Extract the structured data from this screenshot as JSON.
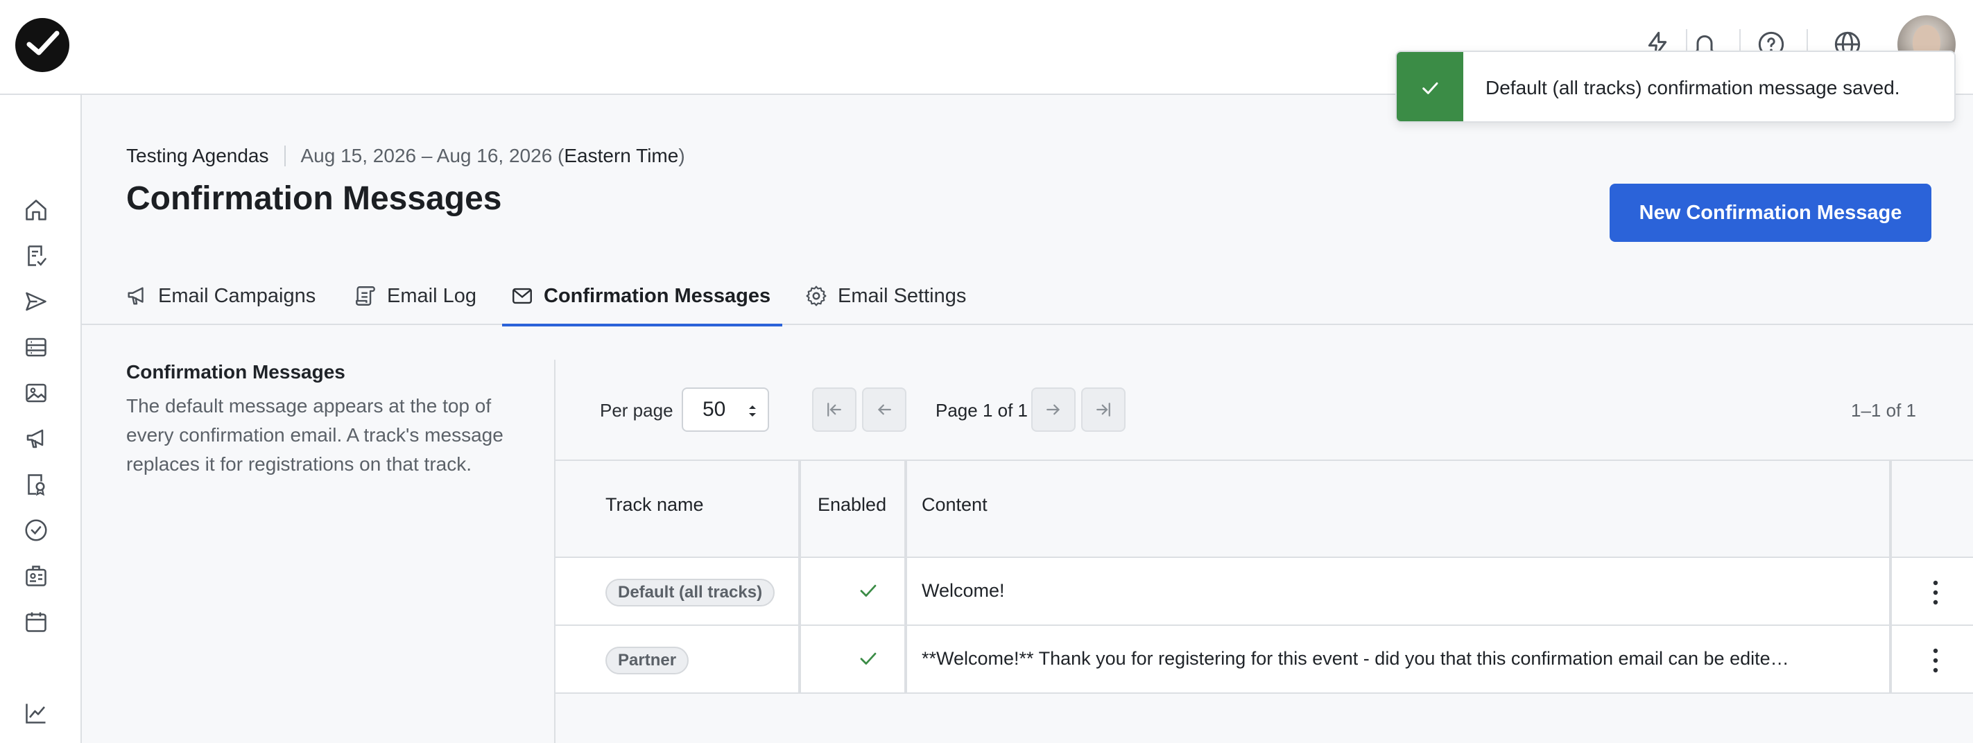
{
  "header": {
    "logo_icon": "checkmark-logo-icon",
    "icons": [
      "lightning-icon",
      "bell-icon",
      "help-icon",
      "globe-icon"
    ],
    "avatar": "user-avatar"
  },
  "sidebar": {
    "items": [
      {
        "icon": "home-icon"
      },
      {
        "icon": "checklist-icon"
      },
      {
        "icon": "send-icon"
      },
      {
        "icon": "list-icon"
      },
      {
        "icon": "image-icon"
      },
      {
        "icon": "megaphone-icon"
      },
      {
        "icon": "badge-search-icon"
      },
      {
        "icon": "check-circle-icon"
      },
      {
        "icon": "id-card-icon"
      },
      {
        "icon": "calendar-icon"
      },
      {
        "icon": "chart-icon"
      }
    ]
  },
  "event": {
    "name": "Testing Agendas",
    "dates": "Aug 15, 2026 – Aug 16, 2026 (",
    "timezone": "Eastern Time",
    "close_paren": ")"
  },
  "page": {
    "title": "Confirmation Messages",
    "new_button": "New Confirmation Message"
  },
  "tabs": [
    {
      "label": "Email Campaigns",
      "icon": "megaphone-icon"
    },
    {
      "label": "Email Log",
      "icon": "log-icon"
    },
    {
      "label": "Confirmation Messages",
      "icon": "envelope-icon",
      "active": true
    },
    {
      "label": "Email Settings",
      "icon": "gear-icon"
    }
  ],
  "description": {
    "title": "Confirmation Messages",
    "text": "The default message appears at the top of every confirmation email. A track's message replaces it for registrations on that track."
  },
  "pagination": {
    "per_page_label": "Per page",
    "per_page_value": "50",
    "page_info": "Page 1 of 1",
    "range_info": "1–1 of 1"
  },
  "table": {
    "columns": [
      "Track name",
      "Enabled",
      "Content"
    ],
    "rows": [
      {
        "track": "Default (all tracks)",
        "enabled": true,
        "content": "Welcome!"
      },
      {
        "track": "Partner",
        "enabled": true,
        "content": "**Welcome!** Thank you for registering for this event - did you that this confirmation email can be edited using ..."
      }
    ]
  },
  "toast": {
    "message": "Default (all tracks) confirmation message saved.",
    "color": "#3b8c46"
  },
  "colors": {
    "accent": "#2b63d9",
    "success": "#3b8c46"
  }
}
